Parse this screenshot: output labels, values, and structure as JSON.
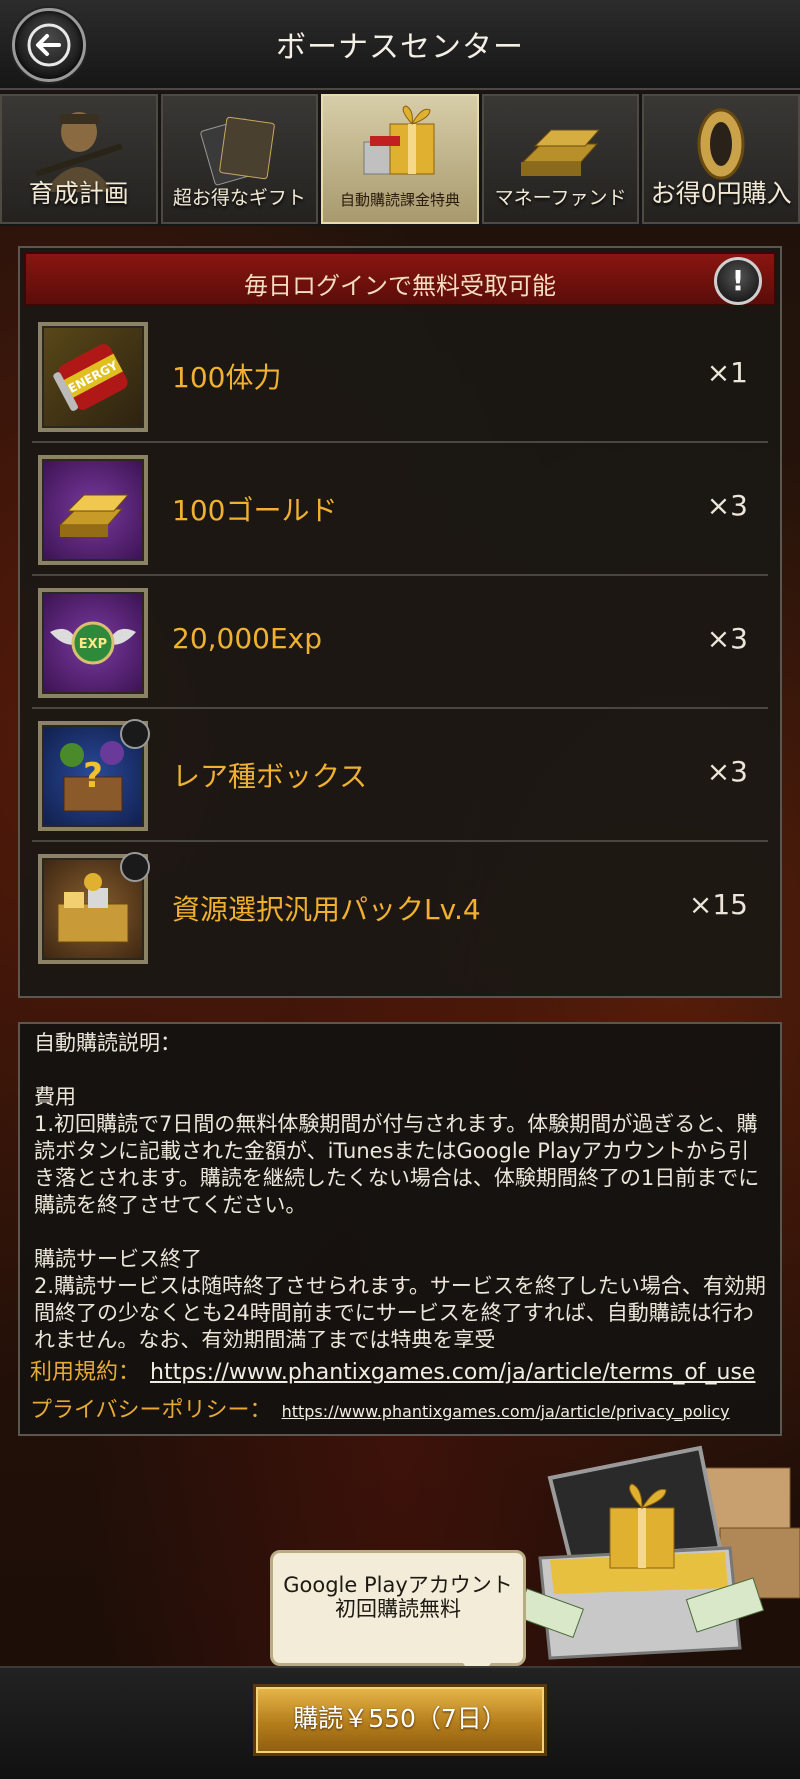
{
  "header": {
    "title": "ボーナスセンター"
  },
  "tabs": [
    {
      "label": "育成計画",
      "active": false
    },
    {
      "label": "超お得なギフト",
      "active": false
    },
    {
      "label": "自動購読課金特典",
      "active": true
    },
    {
      "label": "マネーファンド",
      "active": false
    },
    {
      "label": "お得0円購入",
      "active": false
    }
  ],
  "rewards_panel": {
    "banner": "毎日ログインで無料受取可能",
    "info_glyph": "!",
    "items": [
      {
        "name": "100体力",
        "qty": "×1",
        "icon": "energy-can-icon"
      },
      {
        "name": "100ゴールド",
        "qty": "×3",
        "icon": "gold-bars-icon"
      },
      {
        "name": "20,000Exp",
        "qty": "×3",
        "icon": "exp-badge-icon"
      },
      {
        "name": "レア種ボックス",
        "qty": "×3",
        "icon": "mystery-box-icon"
      },
      {
        "name": "資源選択汎用パックLv.4",
        "qty": "×15",
        "icon": "resource-pack-icon"
      }
    ]
  },
  "description": {
    "title": "自動購読説明：",
    "section1_heading": "費用",
    "section1_text": "1.初回購読で7日間の無料体験期間が付与されます。体験期間が過ぎると、購読ボタンに記載された金額が、iTunesまたはGoogle Playアカウントから引き落とされます。購読を継続したくない場合は、体験期間終了の1日前までに購読を終了させてください。",
    "section2_heading": "購読サービス終了",
    "section2_text": "2.購読サービスは随時終了させられます。サービスを終了したい場合、有効期間終了の少なくとも24時間前までにサービスを終了すれば、自動購読は行われません。なお、有効期間満了までは特典を享受",
    "terms_label": "利用規約：",
    "terms_url": "https://www.phantixgames.com/ja/article/terms_of_use",
    "privacy_label": "プライバシーポリシー：",
    "privacy_url": "https://www.phantixgames.com/ja/article/privacy_policy"
  },
  "promo_bubble": "Google Playアカウント初回購読無料",
  "buy_button": "購読￥550（7日）",
  "colors": {
    "accent_gold": "#f0b030",
    "banner_red": "#8a1510",
    "button_gold": "#e8b84a"
  }
}
